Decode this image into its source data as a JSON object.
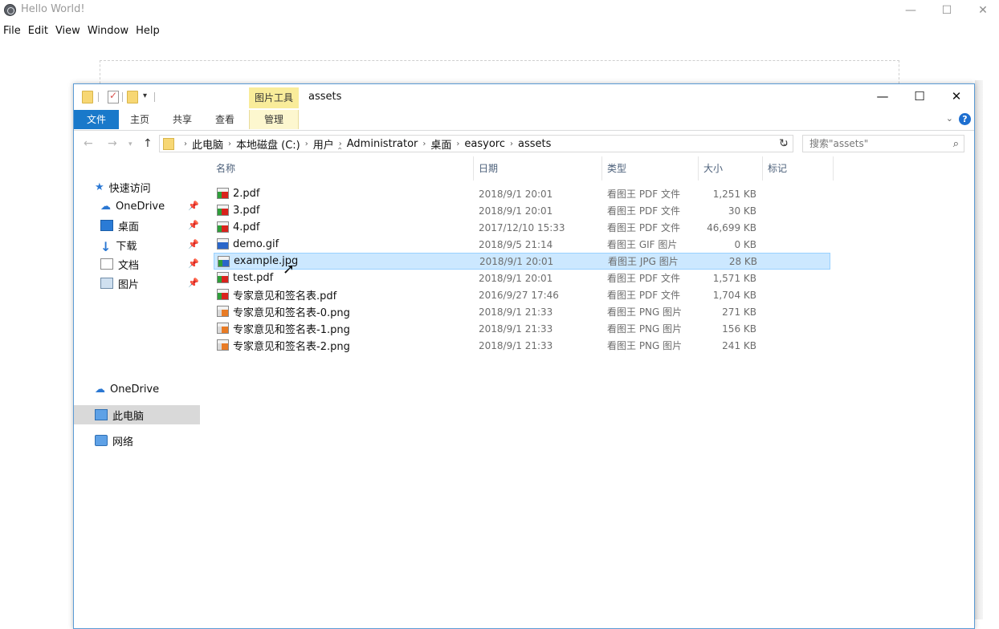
{
  "app": {
    "title": "Hello World!",
    "menu": [
      "File",
      "Edit",
      "View",
      "Window",
      "Help"
    ],
    "controls": {
      "minimize": "—",
      "maximize": "☐",
      "close": "✕"
    }
  },
  "explorer": {
    "title": "assets",
    "context_tab_header": "图片工具",
    "ribbon_tabs": [
      "文件",
      "主页",
      "共享",
      "查看",
      "管理"
    ],
    "breadcrumbs": [
      "此电脑",
      "本地磁盘 (C:)",
      "用户",
      "Administrator",
      "桌面",
      "easyorc",
      "assets"
    ],
    "search_placeholder": "搜索\"assets\"",
    "nav": {
      "quick_access": "快速访问",
      "items": [
        {
          "label": "OneDrive",
          "icon": "cloud-icon"
        },
        {
          "label": "桌面",
          "icon": "desktop-icon"
        },
        {
          "label": "下载",
          "icon": "download-icon"
        },
        {
          "label": "文档",
          "icon": "document-icon"
        },
        {
          "label": "图片",
          "icon": "pictures-icon"
        }
      ],
      "onedrive": "OneDrive",
      "this_pc": "此电脑",
      "network": "网络"
    },
    "columns": [
      "名称",
      "日期",
      "类型",
      "大小",
      "标记"
    ],
    "files": [
      {
        "name": "2.pdf",
        "date": "2018/9/1 20:01",
        "type": "看图王 PDF 文件",
        "size": "1,251 KB",
        "kind": "pdf"
      },
      {
        "name": "3.pdf",
        "date": "2018/9/1 20:01",
        "type": "看图王 PDF 文件",
        "size": "30 KB",
        "kind": "pdf"
      },
      {
        "name": "4.pdf",
        "date": "2017/12/10 15:33",
        "type": "看图王 PDF 文件",
        "size": "46,699 KB",
        "kind": "pdf"
      },
      {
        "name": "demo.gif",
        "date": "2018/9/5 21:14",
        "type": "看图王 GIF 图片",
        "size": "0 KB",
        "kind": "gif"
      },
      {
        "name": "example.jpg",
        "date": "2018/9/1 20:01",
        "type": "看图王 JPG 图片",
        "size": "28 KB",
        "kind": "jpg"
      },
      {
        "name": "test.pdf",
        "date": "2018/9/1 20:01",
        "type": "看图王 PDF 文件",
        "size": "1,571 KB",
        "kind": "pdf"
      },
      {
        "name": "专家意见和签名表.pdf",
        "date": "2016/9/27 17:46",
        "type": "看图王 PDF 文件",
        "size": "1,704 KB",
        "kind": "pdf"
      },
      {
        "name": "专家意见和签名表-0.png",
        "date": "2018/9/1 21:33",
        "type": "看图王 PNG 图片",
        "size": "271 KB",
        "kind": "png"
      },
      {
        "name": "专家意见和签名表-1.png",
        "date": "2018/9/1 21:33",
        "type": "看图王 PNG 图片",
        "size": "156 KB",
        "kind": "png"
      },
      {
        "name": "专家意见和签名表-2.png",
        "date": "2018/9/1 21:33",
        "type": "看图王 PNG 图片",
        "size": "241 KB",
        "kind": "png"
      }
    ],
    "selected_file": "example.jpg"
  }
}
